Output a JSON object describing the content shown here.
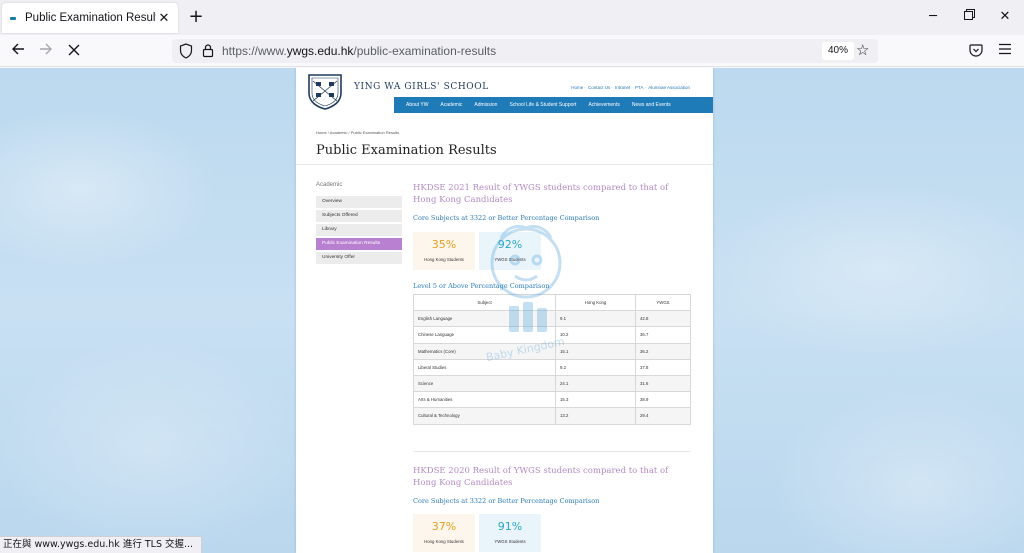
{
  "browser": {
    "tab_title": "Public Examination Results | Ying",
    "url_prefix": "https://www.",
    "url_domain": "ywgs.edu.hk",
    "url_path": "/public-examination-results",
    "zoom": "40%",
    "status_text": "正在與 www.ywgs.edu.hk 進行 TLS 交握..."
  },
  "site": {
    "school_name": "YING WA GIRLS' SCHOOL",
    "top_links": [
      "Home",
      "Contact Us",
      "Intranet",
      "PTA",
      "Alumnae Association"
    ],
    "main_nav": [
      "About YW",
      "Academic",
      "Admission",
      "School Life & Student Support",
      "Achievements",
      "News and Events"
    ],
    "breadcrumb": [
      "Home",
      "Academic",
      "Public Examination Results"
    ],
    "page_title": "Public Examination Results"
  },
  "sidebar": {
    "heading": "Academic",
    "items": [
      "Overview",
      "Subjects Offered",
      "Library",
      "Public Examination Results",
      "University Offer"
    ],
    "active_index": 3
  },
  "hkdse2021": {
    "heading": "HKDSE 2021 Result of YWGS students compared to that of Hong Kong Candidates",
    "core_title": "Core Subjects at 3322 or Better Percentage Comparison",
    "core_hk_value": "35%",
    "core_hk_label": "Hong Kong Students",
    "core_yw_value": "92%",
    "core_yw_label": "YWGS Students",
    "level5_title": "Level 5 or Above Percentage Comparison",
    "table_headers": [
      "Subject",
      "Hong Kong",
      "YWGS"
    ],
    "rows": [
      [
        "English Language",
        "9.1",
        "42.8"
      ],
      [
        "Chinese Language",
        "10.2",
        "36.7"
      ],
      [
        "Mathematics (Core)",
        "15.1",
        "36.2"
      ],
      [
        "Liberal Studies",
        "9.2",
        "37.8"
      ],
      [
        "Science",
        "24.1",
        "31.6"
      ],
      [
        "Arts & Humanities",
        "15.3",
        "38.9"
      ],
      [
        "Cultural & Technology",
        "13.2",
        "29.4"
      ]
    ]
  },
  "hkdse2020": {
    "heading": "HKDSE 2020 Result of YWGS students compared to that of Hong Kong Candidates",
    "core_title": "Core Subjects at 3322 or Better Percentage Comparison",
    "core_hk_value": "37%",
    "core_hk_label": "Hong Kong Students",
    "core_yw_value": "91%",
    "core_yw_label": "YWGS Students"
  },
  "watermark_text": "Baby Kingdom",
  "icons": [
    "back-arrow-icon",
    "forward-arrow-icon",
    "stop-icon",
    "shield-icon",
    "lock-icon",
    "star-icon",
    "pocket-icon",
    "menu-icon",
    "minimize-icon",
    "restore-icon",
    "window-close-icon",
    "plus-icon"
  ]
}
